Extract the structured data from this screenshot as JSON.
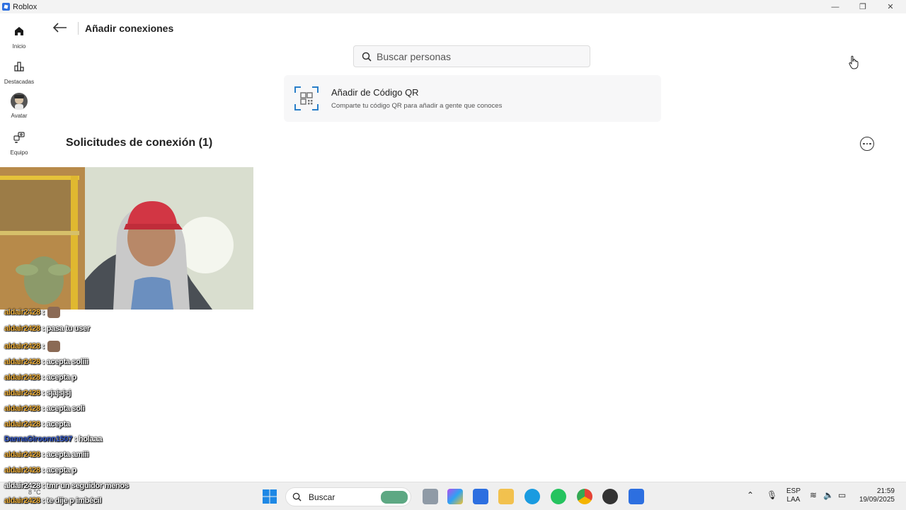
{
  "window": {
    "title": "Roblox",
    "minimize": "—",
    "maximize": "❐",
    "close": "✕"
  },
  "sidebar": {
    "items": [
      {
        "label": "Inicio",
        "icon": "home-icon"
      },
      {
        "label": "Destacadas",
        "icon": "charts-icon"
      },
      {
        "label": "Avatar",
        "icon": "avatar-icon"
      },
      {
        "label": "Equipo",
        "icon": "groups-icon"
      }
    ]
  },
  "header": {
    "title": "Añadir conexiones"
  },
  "search": {
    "placeholder": "Buscar personas"
  },
  "qr_card": {
    "title": "Añadir de Código QR",
    "subtitle": "Comparte tu código QR para añadir a gente que conoces"
  },
  "requests": {
    "title": "Solicitudes de conexión (1)"
  },
  "chat": [
    {
      "user": "aldair2428",
      "text": "",
      "emoji": true
    },
    {
      "user": "aldair2428",
      "text": "pasa tu user"
    },
    {
      "user": "aldair2428",
      "text": "",
      "emoji": true
    },
    {
      "user": "aldair2428",
      "text": "acepta soliii"
    },
    {
      "user": "aldair2428",
      "text": "acepta p"
    },
    {
      "user": "aldair2428",
      "text": "sjajsjsj"
    },
    {
      "user": "aldair2428",
      "text": "acepta soli"
    },
    {
      "user": "aldair2428",
      "text": "acepta"
    },
    {
      "user": "DannaGiroonn1507",
      "text": "holaaa",
      "color": "blue"
    },
    {
      "user": "aldair2428",
      "text": "acepta amiii"
    },
    {
      "user": "aldair2428",
      "text": "acepta p"
    },
    {
      "user": "aldair2428",
      "text": "tmr un seguidor menos"
    },
    {
      "user": "aldair2428",
      "text": "te dije p imbécil"
    }
  ],
  "chat_separator": ":",
  "taskbar": {
    "search_label": "Buscar",
    "weather": "8 °C",
    "lang_top": "ESP",
    "lang_bottom": "LAA",
    "time": "21:59",
    "date": "19/09/2025"
  },
  "colors": {
    "accent": "#2d6fe0",
    "chat_user": "#f0b13c",
    "chat_user_alt": "#3a5fd0"
  }
}
